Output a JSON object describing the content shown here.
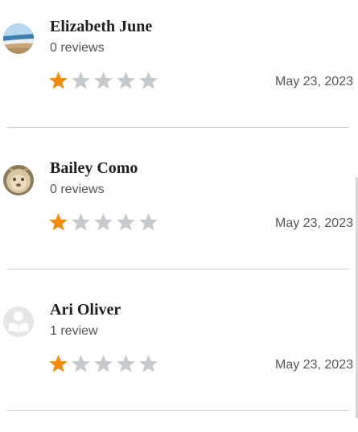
{
  "reviews": [
    {
      "name": "Elizabeth June",
      "review_count": "0 reviews",
      "rating": 1,
      "max_rating": 5,
      "date": "May 23, 2023",
      "avatar": "beach-photo"
    },
    {
      "name": "Bailey Como",
      "review_count": "0 reviews",
      "rating": 1,
      "max_rating": 5,
      "date": "May 23, 2023",
      "avatar": "pet-photo"
    },
    {
      "name": "Ari Oliver",
      "review_count": "1 review",
      "rating": 1,
      "max_rating": 5,
      "date": "May 23, 2023",
      "avatar": "default-reader-icon"
    }
  ],
  "colors": {
    "star_filled": "#f28c0f",
    "star_empty": "#c5c9cd",
    "divider": "#cccccc",
    "name_text": "#1f1f1f",
    "meta_text": "#555555"
  }
}
